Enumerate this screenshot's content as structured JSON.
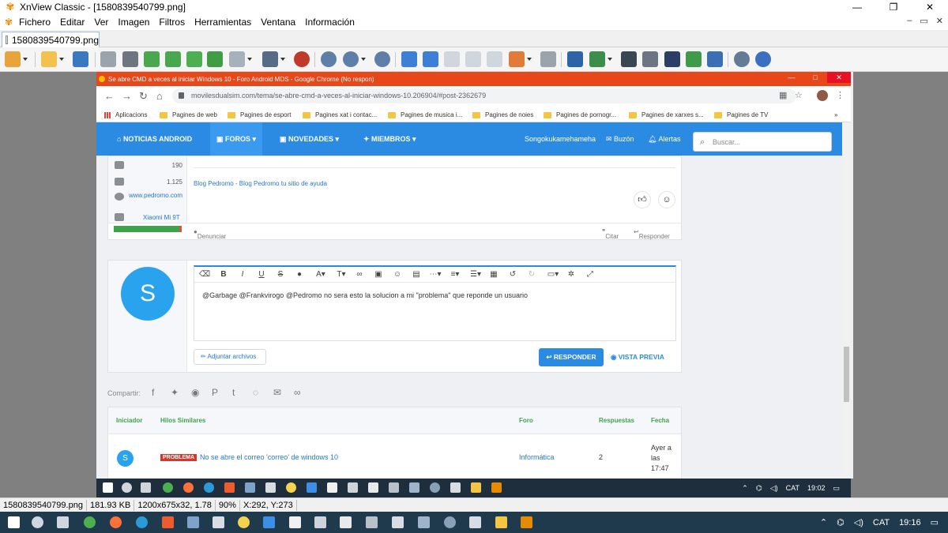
{
  "xnview": {
    "title": "XnView Classic - [1580839540799.png]",
    "window_buttons": [
      "—",
      "❐",
      "✕"
    ],
    "menu": [
      "Fichero",
      "Editar",
      "Ver",
      "Imagen",
      "Filtros",
      "Herramientas",
      "Ventana",
      "Información"
    ],
    "mdi_buttons": [
      "–",
      "▭",
      "✕"
    ],
    "tab_label": "1580839540799.png",
    "status": {
      "filename": "1580839540799.png",
      "size": "181.93 KB",
      "dimensions": "1200x675x32, 1.78",
      "zoom": "90%",
      "coords": "X:292, Y:273"
    }
  },
  "chrome": {
    "title": "Se abre CMD a veces al iniciar Windows 10 - Foro Android MDS - Google Chrome (No respon)",
    "url": "movilesdualsim.com/tema/se-abre-cmd-a-veces-al-iniciar-windows-10.206904/#post-2362679",
    "bookmarks": [
      "Aplicacions",
      "Pagines de web",
      "Pagines de esport",
      "Pagines xat i contac...",
      "Pagines de musica i...",
      "Pagines de noies",
      "Pagines de pornogr...",
      "Pagines de xarxes s...",
      "Pagines de TV"
    ],
    "bookmarks_more": "»"
  },
  "site": {
    "nav": {
      "noticias": "NOTICIAS ANDROID",
      "foros": "FOROS",
      "novedades": "NOVEDADES",
      "miembros": "MIEMBROS",
      "username": "Songokukamehameha",
      "buzon": "Buzón",
      "alertas": "Alertas",
      "search_placeholder": "Buscar..."
    },
    "post": {
      "likes": "190",
      "trophies": "1.125",
      "website": "www.pedromo.com",
      "device": "Xiaomi Mi 9T",
      "signature": "Blog Pedromo - Blog Pedromo tu sitio de ayuda",
      "report": "Denunciar",
      "quote": "Citar",
      "reply": "Responder"
    },
    "reply": {
      "avatar_letter": "S",
      "content": "@Garbage @Frankvirogo @Pedromo no sera esto la solucion a mi \"problema\" que reponde un usuario",
      "attach": "Adjuntar archivos",
      "submit": "RESPONDER",
      "preview": "VISTA PREVIA"
    },
    "share_label": "Compartir:",
    "similar": {
      "headers": [
        "Iniciador",
        "Hilos Similares",
        "Foro",
        "Respuestas",
        "Fecha"
      ],
      "row": {
        "avatar": "S",
        "tag": "PROBLEMA",
        "title": "No se abre el correo 'correo' de windows 10",
        "forum": "Informática",
        "replies": "2",
        "date": "Ayer a las 17:47"
      }
    }
  },
  "inner_tray": {
    "lang": "CAT",
    "time": "19:02"
  },
  "taskbar": {
    "lang": "CAT",
    "time": "19:16"
  },
  "colors": {
    "forum_blue": "#2b8ae2",
    "chrome_titlebar": "#e8471a",
    "green": "#3fa34d"
  }
}
